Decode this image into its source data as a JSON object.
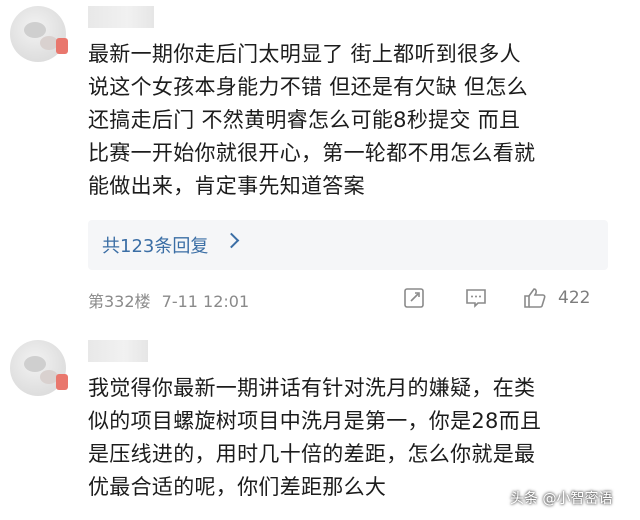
{
  "comments": [
    {
      "text": "最新一期你走后门太明显了  街上都听到很多人\n说这个女孩本身能力不错  但还是有欠缺  但怎么\n还搞走后门  不然黄明睿怎么可能8秒提交   而且\n比赛一开始你就很开心，第一轮都不用怎么看就\n能做出来，肯定事先知道答案",
      "reply_label": "共123条回复",
      "floor": "第332楼",
      "date": "7-11 12:01",
      "likes": "422"
    },
    {
      "text": "我觉得你最新一期讲话有针对洗月的嫌疑，在类\n似的项目螺旋树项目中洗月是第一，你是28而且\n是压线进的，用时几十倍的差距，怎么你就是最\n优最合适的呢，你们差距那么大"
    }
  ],
  "watermark": "头条 @小智密语",
  "icons": [
    "edit-icon",
    "comment-icon",
    "thumbs-up-icon",
    "chevron-right-icon"
  ],
  "colors": {
    "link": "#3b6ea5",
    "meta": "#8a8a8a",
    "reply_bg": "#f5f6f8"
  }
}
